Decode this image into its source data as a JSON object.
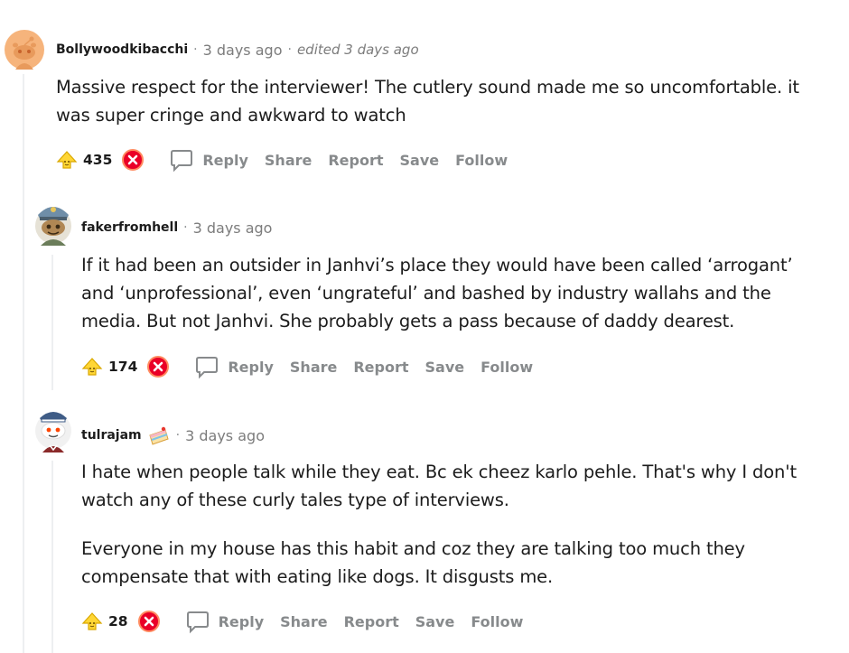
{
  "comments": [
    {
      "author": "Bollywoodkibacchi",
      "time": "3 days ago",
      "edited": "edited 3 days ago",
      "body": [
        "Massive respect for the interviewer! The cutlery sound made me so uncomfortable. it",
        "was super cringe and awkward to watch"
      ],
      "score": "435",
      "avatar_icon": "snoo-orange-avatar"
    },
    {
      "author": "fakerfromhell",
      "time": "3 days ago",
      "body": [
        "If it had been an outsider in Janhvi’s place they would have been called ‘arrogant’",
        "and ‘unprofessional’, even ‘ungrateful’ and bashed by industry wallahs and the",
        "media. But not Janhvi. She probably gets a pass because of daddy dearest."
      ],
      "score": "174",
      "avatar_icon": "snoo-captain-avatar"
    },
    {
      "author": "tulrajam",
      "time": "3 days ago",
      "badge_icon": "cake-icon",
      "body": [
        "I hate when people talk while they eat. Bc ek cheez karlo pehle. That's why I don't",
        "watch any of these curly tales type of interviews."
      ],
      "body2": [
        "Everyone in my house has this habit and coz they are talking too much they",
        "compensate that with eating like dogs. It disgusts me."
      ],
      "score": "28",
      "avatar_icon": "snoo-sailor-avatar"
    }
  ],
  "actions": {
    "reply": "Reply",
    "share": "Share",
    "report": "Report",
    "save": "Save",
    "follow": "Follow"
  },
  "separator": "·",
  "colors": {
    "muted": "#878a8c",
    "text": "#1c1c1c",
    "upvote_yellow": "#ffd635",
    "downvote_red": "#ea0027",
    "thread_line": "#edeff1"
  }
}
